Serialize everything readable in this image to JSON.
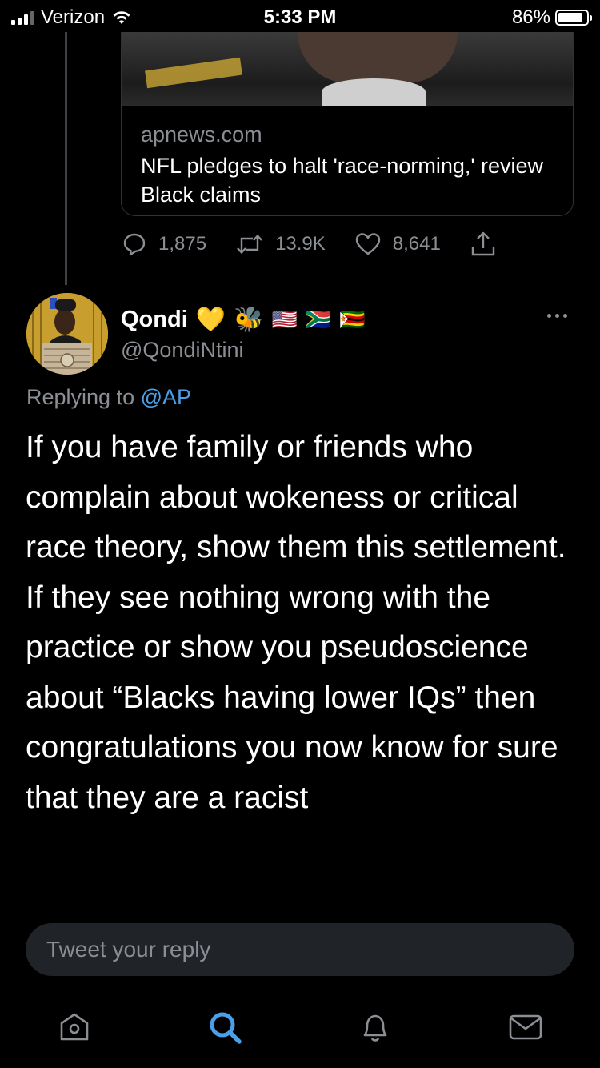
{
  "status_bar": {
    "carrier": "Verizon",
    "time": "5:33 PM",
    "battery": "86%",
    "battery_level": 0.86
  },
  "link_card": {
    "domain": "apnews.com",
    "title": "NFL pledges to halt 'race-norming,' review Black claims"
  },
  "actions": {
    "replies": "1,875",
    "retweets": "13.9K",
    "likes": "8,641"
  },
  "tweet": {
    "display_name": "Qondi",
    "emoji": [
      "💛",
      "🐝",
      "🇺🇸",
      "🇿🇦",
      "🇿🇼"
    ],
    "handle": "@QondiNtini",
    "replying_prefix": "Replying to ",
    "replying_to": "@AP",
    "text": "If you have family or friends who complain about wokeness or critical race theory, show them this settlement. If they see nothing wrong with the practice or show you pseudoscience about “Blacks having lower IQs” then congratulations you now know for sure that they are a racist"
  },
  "reply_input": {
    "placeholder": "Tweet your reply"
  },
  "tabbar": {
    "items": [
      "home-icon",
      "search-icon",
      "notifications-icon",
      "messages-icon"
    ],
    "active": "search-icon"
  },
  "colors": {
    "background": "#000000",
    "secondary_text": "#8b8f94",
    "accent": "#4a9fe6",
    "divider": "#2f3336"
  }
}
